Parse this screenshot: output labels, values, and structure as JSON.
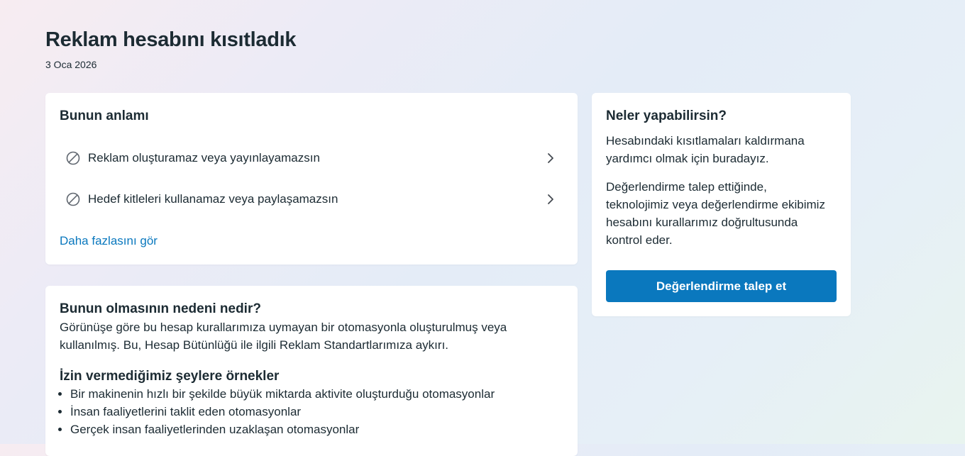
{
  "header": {
    "title": "Reklam hesabını kısıtladık",
    "date": "3 Oca 2026"
  },
  "meaning": {
    "heading": "Bunun anlamı",
    "restrictions": [
      {
        "label": "Reklam oluşturamaz veya yayınlayamazsın",
        "icon": "ban-icon"
      },
      {
        "label": "Hedef kitleleri kullanamaz veya paylaşamazsın",
        "icon": "ban-icon"
      }
    ],
    "see_more": "Daha fazlasını gör"
  },
  "reason": {
    "heading": "Bunun olmasının nedeni nedir?",
    "text": "Görünüşe göre bu hesap kurallarımıza uymayan bir otomasyonla oluşturulmuş veya kullanılmış. Bu, Hesap Bütünlüğü ile ilgili Reklam Standartlarımıza aykırı.",
    "examples_heading": "İzin vermediğimiz şeylere örnekler",
    "examples": [
      "Bir makinenin hızlı bir şekilde büyük miktarda aktivite oluşturduğu otomasyonlar",
      "İnsan faaliyetlerini taklit eden otomasyonlar",
      "Gerçek insan faaliyetlerinden uzaklaşan otomasyonlar"
    ]
  },
  "actions": {
    "heading": "Neler yapabilirsin?",
    "text1": "Hesabındaki kısıtlamaları kaldırmana yardımcı olmak için buradayız.",
    "text2": "Değerlendirme talep ettiğinde, teknolojimiz veya değerlendirme ekibimiz hesabını kurallarımız doğrultusunda kontrol eder.",
    "button_label": "Değerlendirme talep et"
  },
  "colors": {
    "primary": "#0a78be",
    "link": "#0a78be",
    "text": "#1c2b33"
  }
}
